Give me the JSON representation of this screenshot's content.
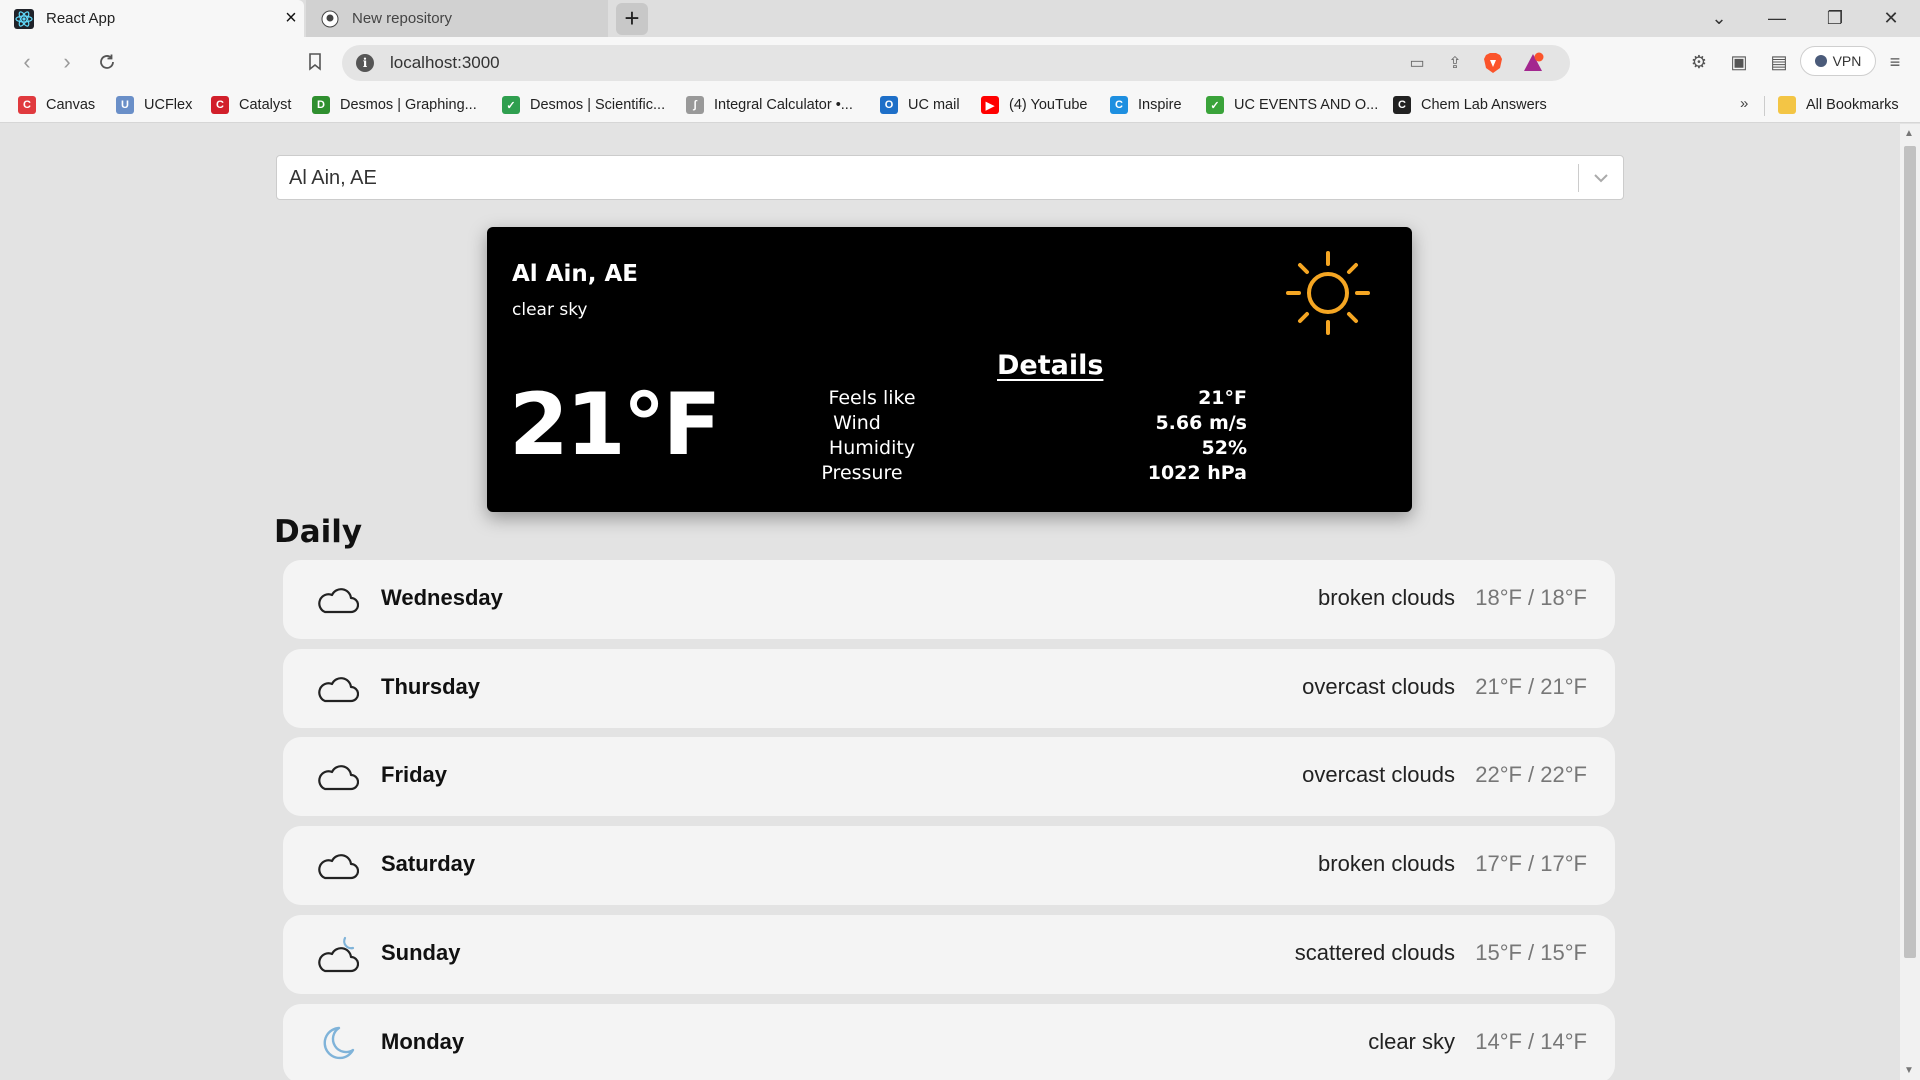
{
  "browser": {
    "tabs": [
      {
        "title": "React App",
        "active": true,
        "icon": "react-icon"
      },
      {
        "title": "New repository",
        "active": false,
        "icon": "github-icon"
      }
    ],
    "url": "localhost:3000",
    "vpn_label": "VPN",
    "bookmarks": [
      {
        "label": "Canvas",
        "icon": "canvas-icon",
        "color": "#e03a3e"
      },
      {
        "label": "UCFlex",
        "icon": "ucflex-icon",
        "color": "#6a8fc8"
      },
      {
        "label": "Catalyst",
        "icon": "catalyst-icon",
        "color": "#d11f2a"
      },
      {
        "label": "Desmos | Graphing...",
        "icon": "desmos-icon",
        "color": "#2f8f2f"
      },
      {
        "label": "Desmos | Scientific...",
        "icon": "desmos-scientific-icon",
        "color": "#2f9f4f"
      },
      {
        "label": "Integral Calculator •...",
        "icon": "integral-icon",
        "color": "#999999"
      },
      {
        "label": "UC mail",
        "icon": "outlook-icon",
        "color": "#1e6fc8"
      },
      {
        "label": "(4) YouTube",
        "icon": "youtube-icon",
        "color": "#ff0000"
      },
      {
        "label": "Inspire",
        "icon": "inspire-icon",
        "color": "#1e8fe0"
      },
      {
        "label": "UC EVENTS AND O...",
        "icon": "ucevents-icon",
        "color": "#3aa33a"
      },
      {
        "label": "Chem Lab Answers",
        "icon": "chemlab-icon",
        "color": "#222222"
      }
    ],
    "bookmarks_more": "»",
    "all_bookmarks": "All Bookmarks"
  },
  "search": {
    "value": "Al Ain, AE"
  },
  "current": {
    "city": "Al Ain, AE",
    "description": "clear sky",
    "temperature": "21°F",
    "icon": "sun-icon",
    "details_title": "Details",
    "details": [
      {
        "label": "Feels like",
        "value": "21°F"
      },
      {
        "label": "Wind",
        "value": "5.66 m/s"
      },
      {
        "label": "Humidity",
        "value": "52%"
      },
      {
        "label": "Pressure",
        "value": "1022 hPa"
      }
    ]
  },
  "daily": {
    "title": "Daily",
    "days": [
      {
        "name": "Wednesday",
        "description": "broken clouds",
        "temps": "18°F / 18°F",
        "icon": "cloud-icon"
      },
      {
        "name": "Thursday",
        "description": "overcast clouds",
        "temps": "21°F / 21°F",
        "icon": "cloud-icon"
      },
      {
        "name": "Friday",
        "description": "overcast clouds",
        "temps": "22°F / 22°F",
        "icon": "cloud-icon"
      },
      {
        "name": "Saturday",
        "description": "broken clouds",
        "temps": "17°F / 17°F",
        "icon": "cloud-icon"
      },
      {
        "name": "Sunday",
        "description": "scattered clouds",
        "temps": "15°F / 15°F",
        "icon": "cloud-moon-icon"
      },
      {
        "name": "Monday",
        "description": "clear sky",
        "temps": "14°F / 14°F",
        "icon": "moon-icon"
      }
    ]
  },
  "colors": {
    "sun": "#f5a623",
    "moon": "#7fb3d9",
    "card_bg": "#000000",
    "page_bg": "#e3e3e3"
  }
}
